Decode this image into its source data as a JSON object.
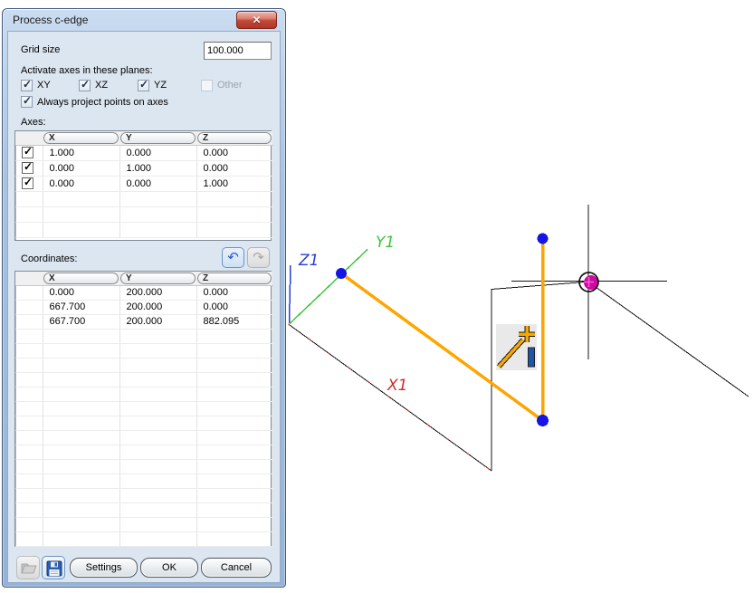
{
  "window": {
    "title": "Process c-edge"
  },
  "icons": {
    "close": "✕",
    "undo": "↶",
    "redo": "↷",
    "check": "✓",
    "open": "open-file-icon",
    "save": "save-icon"
  },
  "form": {
    "grid_size_label": "Grid size",
    "grid_size_value": "100.000",
    "planes_label": "Activate axes in these planes:",
    "planes": [
      {
        "label": "XY",
        "checked": true,
        "enabled": true
      },
      {
        "label": "XZ",
        "checked": true,
        "enabled": true
      },
      {
        "label": "YZ",
        "checked": true,
        "enabled": true
      },
      {
        "label": "Other",
        "checked": false,
        "enabled": false
      }
    ],
    "project_label": "Always project points on axes",
    "project_checked": true
  },
  "axes": {
    "label": "Axes:",
    "columns": [
      "X",
      "Y",
      "Z"
    ],
    "rows": [
      {
        "checked": true,
        "x": "1.000",
        "y": "0.000",
        "z": "0.000"
      },
      {
        "checked": true,
        "x": "0.000",
        "y": "1.000",
        "z": "0.000"
      },
      {
        "checked": true,
        "x": "0.000",
        "y": "0.000",
        "z": "1.000"
      }
    ]
  },
  "coordinates": {
    "label": "Coordinates:",
    "columns": [
      "X",
      "Y",
      "Z"
    ],
    "rows": [
      {
        "x": "0.000",
        "y": "200.000",
        "z": "0.000"
      },
      {
        "x": "667.700",
        "y": "200.000",
        "z": "0.000"
      },
      {
        "x": "667.700",
        "y": "200.000",
        "z": "882.095"
      }
    ]
  },
  "footer": {
    "settings": "Settings",
    "ok": "OK",
    "cancel": "Cancel"
  },
  "viewport": {
    "axis_labels": {
      "x1": "X1",
      "y1": "Y1",
      "z1": "Z1"
    },
    "colors": {
      "x_axis": "#d42a2a",
      "y_axis": "#3fc43f",
      "z_axis": "#2a3fd4",
      "edge": "#141414",
      "polyline": "#ffa500",
      "point": "#1515e6",
      "cursor_dot": "#cc0aa0"
    }
  }
}
